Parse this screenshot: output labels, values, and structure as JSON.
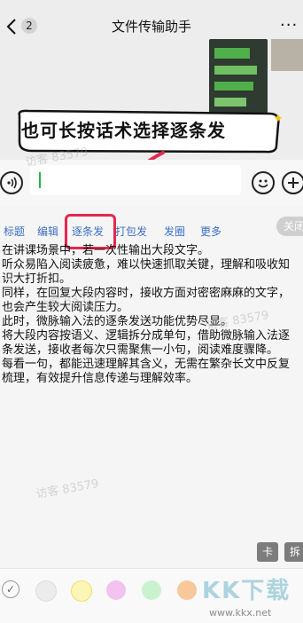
{
  "header": {
    "title": "文件传输助手",
    "unread_badge": "2",
    "more_icon": "···"
  },
  "callout": {
    "text": "也可长按话术选择逐条发"
  },
  "input": {
    "value": ""
  },
  "toolbar": {
    "items": [
      "标题",
      "编辑",
      "逐条发",
      "打包发",
      "发圈",
      "更多"
    ],
    "close_label": "关闭"
  },
  "content": {
    "paragraphs": [
      "在讲课场景中，若一次性输出大段文字。",
      "听众易陷入阅读疲惫，难以快速抓取关键，理解和吸收知识大打折扣。",
      "同样，在回复大段内容时，接收方面对密密麻麻的文字，也会产生较大阅读压力。",
      "此时，微脉输入法的逐条发送功能优势尽显。",
      "将大段内容按语义、逻辑拆分成单句，借助微脉输入法逐条发送，接收者每次只需聚焦一小句，阅读难度骤降。",
      "每看一句，都能迅速理解其含义，无需在繁杂长文中反复梳理，有效提升信息传递与理解效率。"
    ],
    "watermark": "访客 83579"
  },
  "side_buttons": {
    "card": "卡",
    "card2": "拆"
  },
  "colorbar": {
    "check": "✓",
    "swatches": [
      "#ececec",
      "#fbf6b8",
      "#f4c2ef",
      "#c9f3cf",
      "#f8c79a"
    ]
  },
  "logo": {
    "text": "KK下载",
    "url": "www.kkx.net"
  }
}
